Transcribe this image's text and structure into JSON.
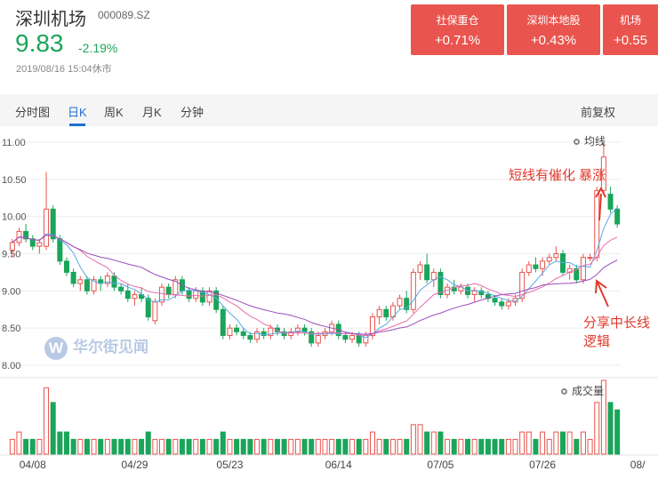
{
  "header": {
    "name": "深圳机场",
    "code": "000089.SZ",
    "price": "9.83",
    "change": "-2.19%",
    "time": "2019/08/16 15:04休市"
  },
  "sectors": [
    {
      "name": "社保重仓",
      "value": "+0.71%"
    },
    {
      "name": "深圳本地股",
      "value": "+0.43%"
    },
    {
      "name": "机场",
      "value": "+0.55"
    }
  ],
  "tabs": [
    "分时图",
    "日K",
    "周K",
    "月K",
    "分钟"
  ],
  "active_tab": "日K",
  "fq_label": "前复权",
  "legend": {
    "ma": "均线",
    "volume": "成交量"
  },
  "annotations": {
    "top": "短线有催化 暴涨",
    "bottom_line1": "分享中长线",
    "bottom_line2": "逻辑"
  },
  "watermark": "华尔街见闻",
  "colors": {
    "up": "#e9544e",
    "down": "#1aa55a",
    "accent": "#1c6fd1"
  },
  "chart_data": {
    "type": "candlestick",
    "y_ticks": [
      "11.00",
      "10.50",
      "10.00",
      "9.50",
      "9.00",
      "8.50",
      "8.00"
    ],
    "ylim": [
      8.0,
      11.0
    ],
    "x_ticks": [
      {
        "label": "04/08",
        "index": 3
      },
      {
        "label": "04/29",
        "index": 18
      },
      {
        "label": "05/23",
        "index": 32
      },
      {
        "label": "06/14",
        "index": 48
      },
      {
        "label": "07/05",
        "index": 63
      },
      {
        "label": "07/26",
        "index": 78
      },
      {
        "label": "08/",
        "index": 92
      }
    ],
    "candles": [
      [
        9.55,
        9.7,
        9.45,
        9.65
      ],
      [
        9.65,
        9.85,
        9.6,
        9.8
      ],
      [
        9.8,
        9.9,
        9.65,
        9.7
      ],
      [
        9.7,
        9.75,
        9.55,
        9.6
      ],
      [
        9.6,
        9.7,
        9.5,
        9.65
      ],
      [
        9.6,
        10.6,
        9.55,
        10.1
      ],
      [
        10.1,
        10.15,
        9.65,
        9.7
      ],
      [
        9.7,
        9.75,
        9.35,
        9.4
      ],
      [
        9.4,
        9.45,
        9.2,
        9.25
      ],
      [
        9.25,
        9.3,
        9.05,
        9.1
      ],
      [
        9.1,
        9.2,
        9.0,
        9.15
      ],
      [
        9.15,
        9.2,
        8.95,
        9.0
      ],
      [
        9.0,
        9.2,
        8.95,
        9.15
      ],
      [
        9.15,
        9.2,
        9.0,
        9.1
      ],
      [
        9.1,
        9.25,
        9.05,
        9.2
      ],
      [
        9.2,
        9.25,
        9.0,
        9.05
      ],
      [
        9.05,
        9.1,
        8.95,
        9.0
      ],
      [
        9.0,
        9.1,
        8.85,
        8.9
      ],
      [
        8.9,
        9.0,
        8.8,
        8.95
      ],
      [
        8.95,
        9.05,
        8.85,
        8.9
      ],
      [
        8.9,
        8.95,
        8.6,
        8.65
      ],
      [
        8.6,
        8.9,
        8.55,
        8.85
      ],
      [
        8.85,
        9.1,
        8.8,
        9.05
      ],
      [
        9.05,
        9.1,
        8.9,
        8.95
      ],
      [
        8.95,
        9.2,
        8.9,
        9.15
      ],
      [
        9.15,
        9.2,
        8.95,
        9.0
      ],
      [
        9.0,
        9.05,
        8.85,
        8.9
      ],
      [
        8.9,
        9.05,
        8.85,
        9.0
      ],
      [
        9.0,
        9.05,
        8.8,
        8.85
      ],
      [
        8.85,
        9.05,
        8.8,
        9.0
      ],
      [
        9.0,
        9.05,
        8.7,
        8.75
      ],
      [
        8.75,
        8.8,
        8.35,
        8.4
      ],
      [
        8.4,
        8.55,
        8.35,
        8.5
      ],
      [
        8.5,
        8.55,
        8.4,
        8.45
      ],
      [
        8.45,
        8.5,
        8.35,
        8.4
      ],
      [
        8.4,
        8.45,
        8.3,
        8.35
      ],
      [
        8.35,
        8.5,
        8.3,
        8.45
      ],
      [
        8.45,
        8.5,
        8.35,
        8.4
      ],
      [
        8.4,
        8.55,
        8.35,
        8.5
      ],
      [
        8.5,
        8.55,
        8.4,
        8.45
      ],
      [
        8.45,
        8.5,
        8.35,
        8.4
      ],
      [
        8.4,
        8.5,
        8.35,
        8.45
      ],
      [
        8.45,
        8.55,
        8.4,
        8.5
      ],
      [
        8.5,
        8.55,
        8.4,
        8.45
      ],
      [
        8.45,
        8.5,
        8.25,
        8.3
      ],
      [
        8.3,
        8.45,
        8.25,
        8.4
      ],
      [
        8.4,
        8.5,
        8.35,
        8.45
      ],
      [
        8.45,
        8.6,
        8.4,
        8.55
      ],
      [
        8.55,
        8.6,
        8.35,
        8.4
      ],
      [
        8.4,
        8.45,
        8.3,
        8.35
      ],
      [
        8.35,
        8.45,
        8.3,
        8.4
      ],
      [
        8.4,
        8.45,
        8.25,
        8.3
      ],
      [
        8.3,
        8.45,
        8.25,
        8.4
      ],
      [
        8.4,
        8.7,
        8.35,
        8.65
      ],
      [
        8.65,
        8.8,
        8.55,
        8.75
      ],
      [
        8.75,
        8.8,
        8.6,
        8.65
      ],
      [
        8.65,
        8.85,
        8.6,
        8.8
      ],
      [
        8.8,
        8.95,
        8.75,
        8.9
      ],
      [
        8.9,
        9.0,
        8.7,
        8.75
      ],
      [
        8.75,
        9.3,
        8.7,
        9.25
      ],
      [
        9.25,
        9.4,
        9.15,
        9.35
      ],
      [
        9.35,
        9.5,
        9.1,
        9.15
      ],
      [
        9.15,
        9.3,
        9.05,
        9.25
      ],
      [
        9.25,
        9.3,
        8.9,
        8.95
      ],
      [
        8.95,
        9.1,
        8.9,
        9.05
      ],
      [
        9.05,
        9.15,
        8.95,
        9.0
      ],
      [
        9.0,
        9.1,
        8.95,
        9.05
      ],
      [
        9.05,
        9.1,
        8.9,
        8.95
      ],
      [
        8.95,
        9.05,
        8.85,
        9.0
      ],
      [
        9.0,
        9.05,
        8.9,
        8.95
      ],
      [
        8.95,
        9.0,
        8.85,
        8.9
      ],
      [
        8.9,
        8.95,
        8.8,
        8.85
      ],
      [
        8.85,
        8.9,
        8.75,
        8.8
      ],
      [
        8.8,
        8.9,
        8.75,
        8.85
      ],
      [
        8.85,
        8.95,
        8.8,
        8.9
      ],
      [
        8.9,
        9.3,
        8.85,
        9.25
      ],
      [
        9.25,
        9.4,
        9.2,
        9.35
      ],
      [
        9.35,
        9.45,
        9.25,
        9.3
      ],
      [
        9.3,
        9.45,
        9.2,
        9.4
      ],
      [
        9.4,
        9.5,
        9.35,
        9.45
      ],
      [
        9.45,
        9.6,
        9.4,
        9.5
      ],
      [
        9.5,
        9.55,
        9.2,
        9.25
      ],
      [
        9.25,
        9.35,
        9.15,
        9.3
      ],
      [
        9.3,
        9.35,
        9.1,
        9.15
      ],
      [
        9.15,
        9.5,
        9.1,
        9.45
      ],
      [
        9.45,
        9.5,
        9.4,
        9.45
      ],
      [
        9.45,
        10.4,
        9.4,
        10.35
      ],
      [
        10.35,
        11.0,
        10.3,
        10.8
      ],
      [
        10.3,
        10.4,
        10.05,
        10.1
      ],
      [
        10.1,
        10.15,
        9.85,
        9.9
      ]
    ],
    "volumes": [
      2,
      3,
      2,
      2,
      2,
      9,
      7,
      3,
      3,
      2,
      2,
      2,
      2,
      2,
      2,
      2,
      2,
      2,
      2,
      2,
      3,
      2,
      2,
      2,
      2,
      2,
      2,
      2,
      2,
      2,
      2,
      3,
      2,
      2,
      2,
      2,
      2,
      2,
      2,
      2,
      2,
      2,
      2,
      2,
      2,
      2,
      2,
      2,
      2,
      2,
      2,
      2,
      2,
      3,
      2,
      2,
      2,
      2,
      2,
      4,
      4,
      3,
      3,
      3,
      2,
      2,
      2,
      2,
      2,
      2,
      2,
      2,
      2,
      2,
      2,
      3,
      3,
      2,
      3,
      2,
      3,
      3,
      3,
      2,
      3,
      2,
      7,
      10,
      7,
      6
    ],
    "vol_max": 10
  }
}
